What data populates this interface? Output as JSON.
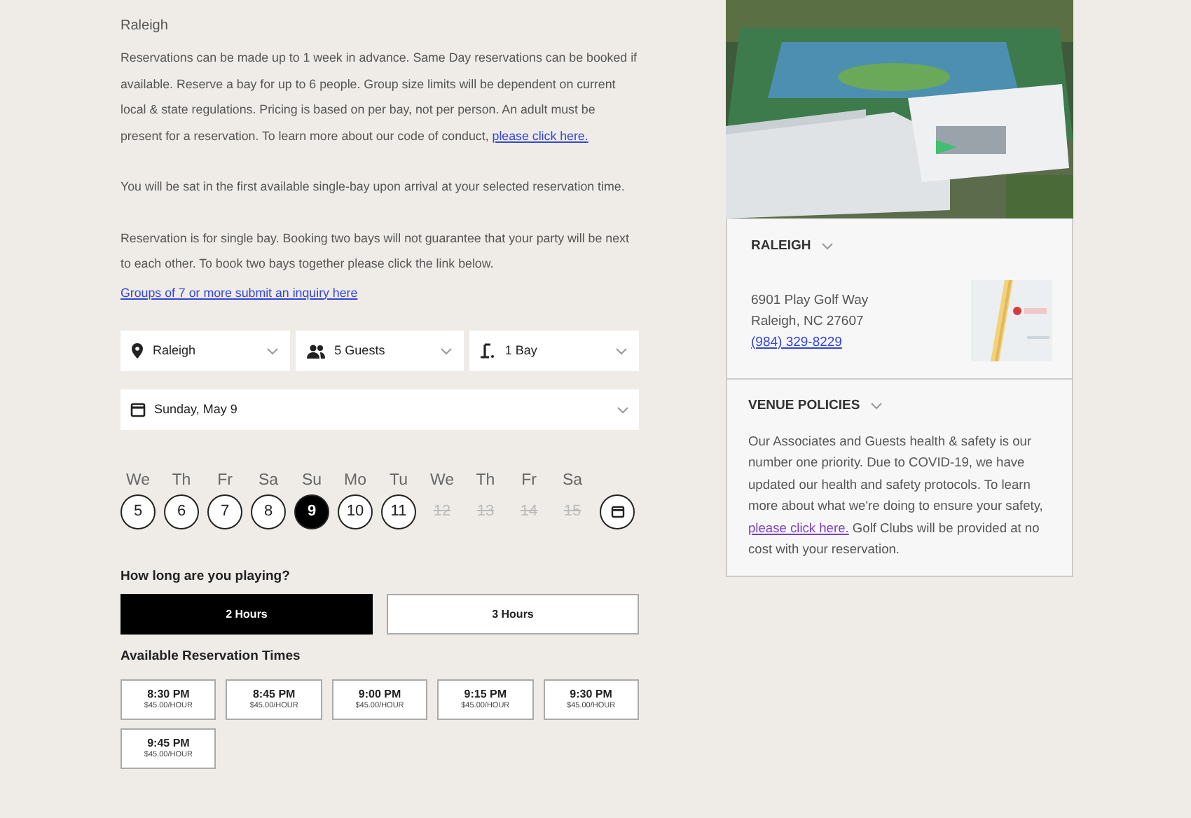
{
  "location_label": "Raleigh",
  "paragraphs": [
    {
      "text": "Reservations can be made up to 1 week in advance. Same Day reservations can be booked if available. Reserve a bay for up to 6 people. Group size limits will be dependent on current local & state regulations. Pricing is based on per bay, not per person. An adult must be present for a reservation. To learn more about our code of conduct, ",
      "link": "please click here."
    },
    {
      "text": "You will be sat in the first available single-bay upon arrival at your selected reservation time."
    },
    {
      "text": "Reservation is for single bay. Booking two bays will not guarantee that your party will be next to each other. To book two bays together please click the link below."
    }
  ],
  "group_link": "Groups of 7 or more submit an inquiry here",
  "selects": [
    {
      "kind": "location",
      "value": "Raleigh"
    },
    {
      "kind": "guests",
      "value": "5 Guests"
    },
    {
      "kind": "bays",
      "value": "1 Bay"
    }
  ],
  "date_select": {
    "value": "Sunday, May 9"
  },
  "days": [
    {
      "weekday": "We",
      "day": "5",
      "selected": false,
      "disabled": false
    },
    {
      "weekday": "Th",
      "day": "6",
      "selected": false,
      "disabled": false
    },
    {
      "weekday": "Fr",
      "day": "7",
      "selected": false,
      "disabled": false
    },
    {
      "weekday": "Sa",
      "day": "8",
      "selected": false,
      "disabled": false
    },
    {
      "weekday": "Su",
      "day": "9",
      "selected": true,
      "disabled": false
    },
    {
      "weekday": "Mo",
      "day": "10",
      "selected": false,
      "disabled": false
    },
    {
      "weekday": "Tu",
      "day": "11",
      "selected": false,
      "disabled": false
    },
    {
      "weekday": "We",
      "day": "12",
      "selected": false,
      "disabled": true
    },
    {
      "weekday": "Th",
      "day": "13",
      "selected": false,
      "disabled": true
    },
    {
      "weekday": "Fr",
      "day": "14",
      "selected": false,
      "disabled": true
    },
    {
      "weekday": "Sa",
      "day": "15",
      "selected": false,
      "disabled": true
    }
  ],
  "duration_heading": "How long are you playing?",
  "durations": [
    {
      "label": "2 Hours",
      "selected": true
    },
    {
      "label": "3 Hours",
      "selected": false
    }
  ],
  "times_heading": "Available Reservation Times",
  "times": [
    {
      "time": "8:30 PM",
      "price": "$45.00/HOUR"
    },
    {
      "time": "8:45 PM",
      "price": "$45.00/HOUR"
    },
    {
      "time": "9:00 PM",
      "price": "$45.00/HOUR"
    },
    {
      "time": "9:15 PM",
      "price": "$45.00/HOUR"
    },
    {
      "time": "9:30 PM",
      "price": "$45.00/HOUR"
    },
    {
      "time": "9:45 PM",
      "price": "$45.00/HOUR"
    }
  ],
  "venue": {
    "heading": "RALEIGH",
    "address_lines": [
      "6901 Play Golf Way",
      "Raleigh, NC 27607"
    ],
    "phone": "(984) 329-8229"
  },
  "policies": {
    "heading": "VENUE POLICIES",
    "text_before": "Our Associates and Guests health & safety is our number one priority. Due to COVID-19, we have updated our health and safety protocols. To learn more about what we're doing to ensure your safety, ",
    "link": "please click here.",
    "text_after": " Golf Clubs will be provided at no cost with your reservation."
  }
}
